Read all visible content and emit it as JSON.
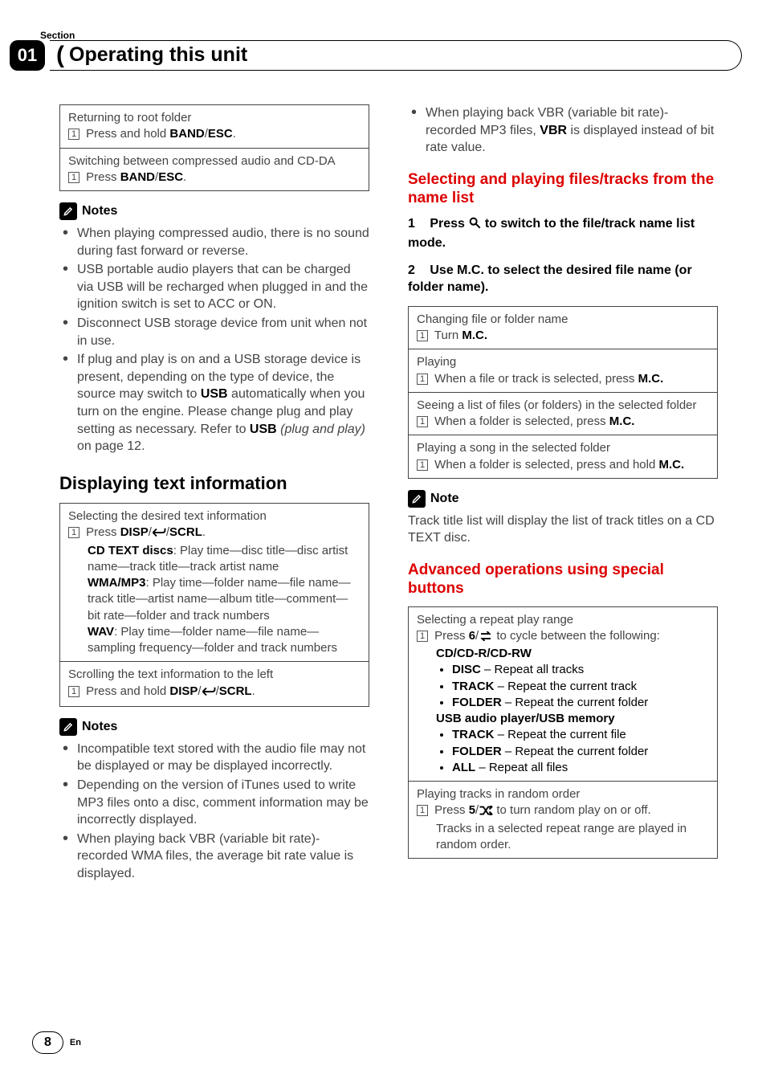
{
  "section_label": "Section",
  "section_number": "01",
  "page_title": "Operating this unit",
  "page_number": "8",
  "page_lang": "En",
  "left": {
    "boxA": {
      "row1_title": "Returning to root folder",
      "row1_instr_prefix": "Press and hold ",
      "row1_instr_bold1": "BAND",
      "row1_instr_mid": "/",
      "row1_instr_bold2": "ESC",
      "row1_instr_suffix": ".",
      "row2_title": "Switching between compressed audio and CD-DA",
      "row2_instr_prefix": "Press ",
      "row2_instr_bold1": "BAND",
      "row2_instr_mid": "/",
      "row2_instr_bold2": "ESC",
      "row2_instr_suffix": "."
    },
    "notes1_label": "Notes",
    "notes1": [
      "When playing compressed audio, there is no sound during fast forward or reverse.",
      "USB portable audio players that can be charged via USB will be recharged when plugged in and the ignition switch is set to ACC or ON.",
      "Disconnect USB storage device from unit when not in use."
    ],
    "notes1_last_pre": "If plug and play is on and a USB storage device is present, depending on the type of device, the source may switch to ",
    "notes1_last_bold": "USB",
    "notes1_last_mid": " automatically when you turn on the engine. Please change plug and play setting as necessary. Refer to ",
    "notes1_last_bold2": "USB",
    "notes1_last_ital": " (plug and play)",
    "notes1_last_tail": " on page 12.",
    "h2_display": "Displaying text information",
    "boxB": {
      "row1_title": "Selecting the desired text information",
      "row1_instr_prefix": "Press ",
      "row1_instr_bold1": "DISP",
      "row1_instr_mid1": "/",
      "row1_instr_mid2": "/",
      "row1_instr_bold2": "SCRL",
      "row1_instr_suffix": ".",
      "cdtext_label": "CD TEXT discs",
      "cdtext_body": ": Play time—disc title—disc artist name—track title—track artist name",
      "wma_label": "WMA/MP3",
      "wma_body": ": Play time—folder name—file name—track title—artist name—album title—comment—bit rate—folder and track numbers",
      "wav_label": "WAV",
      "wav_body": ": Play time—folder name—file name—sampling frequency—folder and track numbers",
      "row2_title": "Scrolling the text information to the left",
      "row2_instr_prefix": "Press and hold ",
      "row2_instr_bold1": "DISP",
      "row2_instr_mid1": "/",
      "row2_instr_mid2": "/",
      "row2_instr_bold2": "SCRL",
      "row2_instr_suffix": "."
    },
    "notes2_label": "Notes",
    "notes2": [
      "Incompatible text stored with the audio file may not be displayed or may be displayed incorrectly.",
      "Depending on the version of iTunes used to write MP3 files onto a disc, comment information may be incorrectly displayed.",
      "When playing back VBR (variable bit rate)-recorded WMA files, the average bit rate value is displayed."
    ]
  },
  "right": {
    "top_bullet_pre": "When playing back VBR (variable bit rate)-recorded MP3 files, ",
    "top_bullet_bold": "VBR",
    "top_bullet_post": " is displayed instead of bit rate value.",
    "h2_select": "Selecting and playing files/tracks from the name list",
    "step1_num": "1",
    "step1_pre": "Press ",
    "step1_post": " to switch to the file/track name list mode.",
    "step2_num": "2",
    "step2_text": "Use M.C. to select the desired file name (or folder name).",
    "boxC": {
      "r1_title": "Changing file or folder name",
      "r1_instr_pre": "Turn ",
      "r1_instr_bold": "M.C.",
      "r2_title": "Playing",
      "r2_instr_pre": "When a file or track is selected, press ",
      "r2_instr_bold": "M.C.",
      "r3_title": "Seeing a list of files (or folders) in the selected folder",
      "r3_instr_pre": "When a folder is selected, press ",
      "r3_instr_bold": "M.C.",
      "r4_title": "Playing a song in the selected folder",
      "r4_instr_pre": "When a folder is selected, press and hold ",
      "r4_instr_bold": "M.C."
    },
    "note_label": "Note",
    "note_body": "Track title list will display the list of track titles on a CD TEXT disc.",
    "h2_adv": "Advanced operations using special buttons",
    "boxD": {
      "r1_title": "Selecting a repeat play range",
      "r1_instr_pre": "Press ",
      "r1_instr_bold": "6",
      "r1_instr_mid": "/",
      "r1_instr_post": " to cycle between the following:",
      "cd_label": "CD/CD-R/CD-RW",
      "cd_items": [
        {
          "b": "DISC",
          "t": " – Repeat all tracks"
        },
        {
          "b": "TRACK",
          "t": " – Repeat the current track"
        },
        {
          "b": "FOLDER",
          "t": " – Repeat the current folder"
        }
      ],
      "usb_label": "USB audio player/USB memory",
      "usb_items": [
        {
          "b": "TRACK",
          "t": " – Repeat the current file"
        },
        {
          "b": "FOLDER",
          "t": " – Repeat the current folder"
        },
        {
          "b": "ALL",
          "t": " – Repeat all files"
        }
      ],
      "r2_title": "Playing tracks in random order",
      "r2_instr_pre": "Press ",
      "r2_instr_bold": "5",
      "r2_instr_mid": "/",
      "r2_instr_post": " to turn random play on or off.",
      "r2_extra": "Tracks in a selected repeat range are played in random order."
    }
  }
}
